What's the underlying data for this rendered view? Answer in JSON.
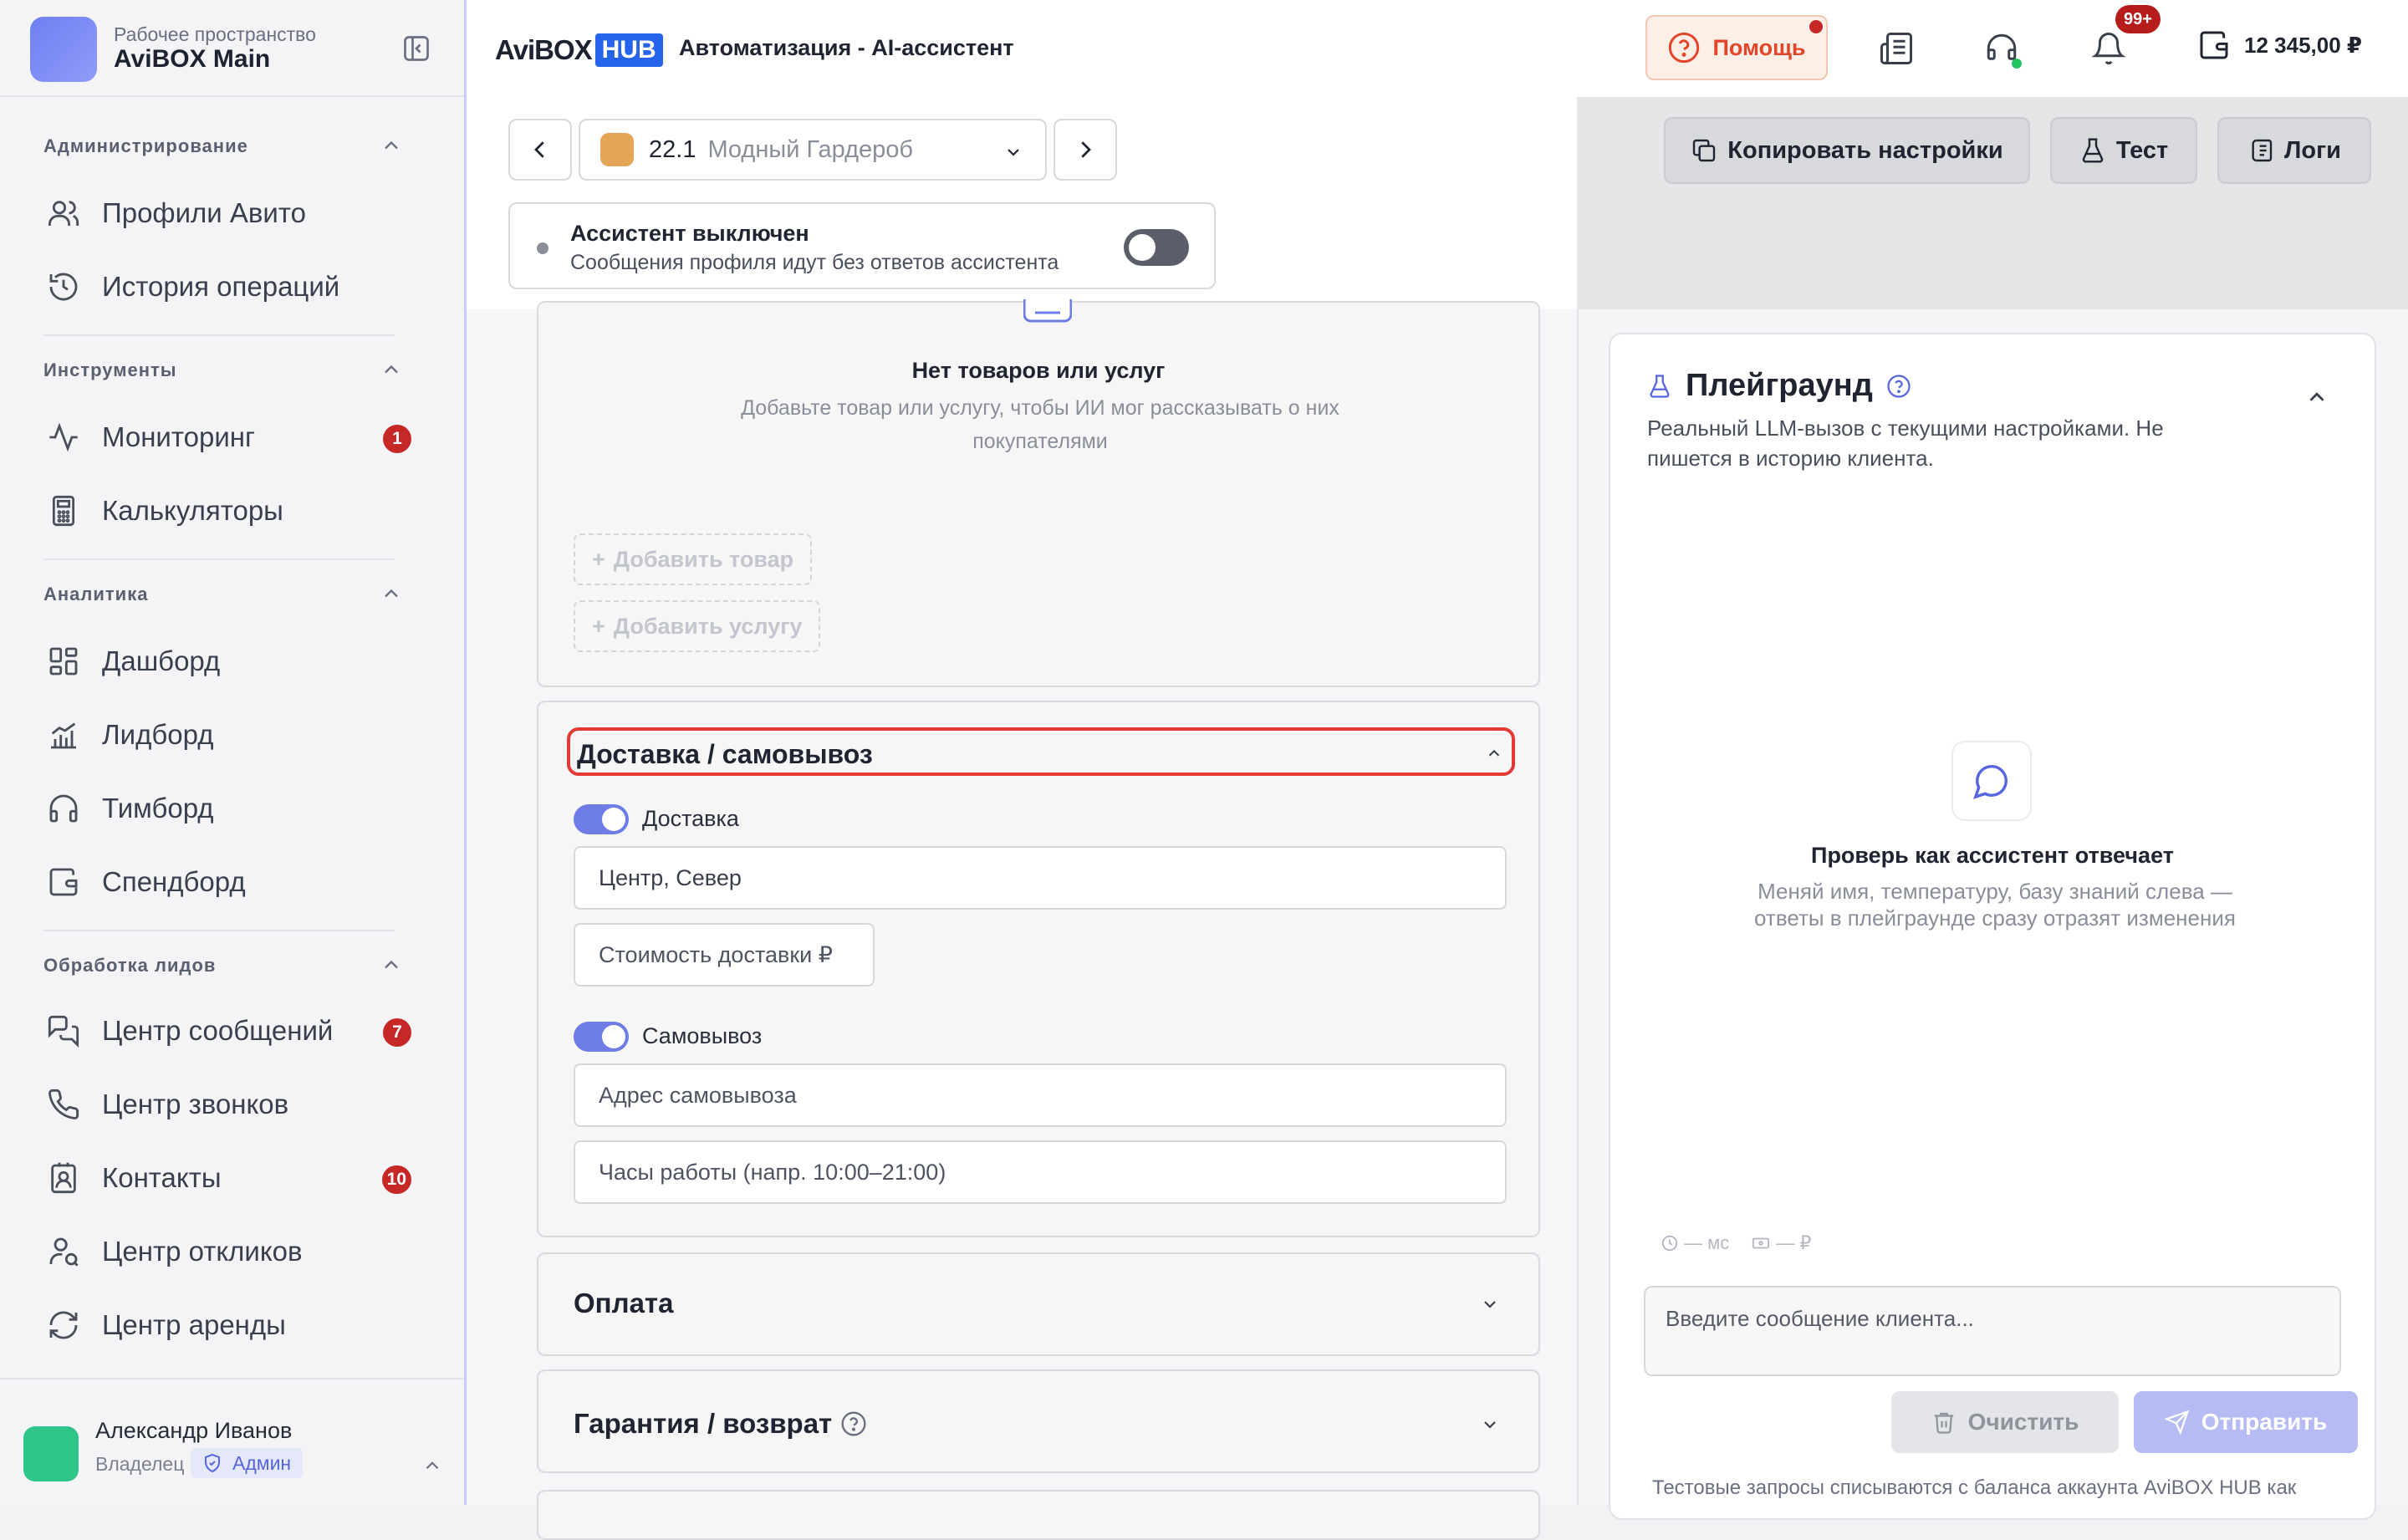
{
  "workspace": {
    "subtitle": "Рабочее пространство",
    "name": "AviBOX Main"
  },
  "sidebar": {
    "sections": [
      {
        "title": "Администрирование",
        "items": [
          {
            "label": "Профили Авито",
            "icon": "users-icon"
          },
          {
            "label": "История операций",
            "icon": "history-icon"
          }
        ]
      },
      {
        "title": "Инструменты",
        "items": [
          {
            "label": "Мониторинг",
            "icon": "activity-icon",
            "badge": "1"
          },
          {
            "label": "Калькуляторы",
            "icon": "calculator-icon"
          }
        ]
      },
      {
        "title": "Аналитика",
        "items": [
          {
            "label": "Дашборд",
            "icon": "dashboard-icon"
          },
          {
            "label": "Лидборд",
            "icon": "bar-chart-icon"
          },
          {
            "label": "Тимборд",
            "icon": "headphones-icon"
          },
          {
            "label": "Спендборд",
            "icon": "wallet-icon"
          }
        ]
      },
      {
        "title": "Обработка лидов",
        "items": [
          {
            "label": "Центр сообщений",
            "icon": "messages-icon",
            "badge": "7"
          },
          {
            "label": "Центр звонков",
            "icon": "phone-icon"
          },
          {
            "label": "Контакты",
            "icon": "contacts-icon",
            "badge": "10"
          },
          {
            "label": "Центр откликов",
            "icon": "user-response-icon"
          },
          {
            "label": "Центр аренды",
            "icon": "refresh-icon"
          }
        ]
      }
    ]
  },
  "user": {
    "name": "Александр Иванов",
    "role": "Владелец",
    "badge": "Админ"
  },
  "topbar": {
    "brand": "AviBOX",
    "brand_hub": "HUB",
    "title": "Автоматизация - AI-ассистент",
    "help": "Помощь",
    "notifications": "99+",
    "balance": "12 345,00 ₽"
  },
  "profile": {
    "number": "22.1",
    "name": "Модный Гардероб"
  },
  "assistant": {
    "title": "Ассистент выключен",
    "subtitle": "Сообщения профиля идут без ответов ассистента",
    "enabled": false
  },
  "actions": {
    "copy": "Копировать настройки",
    "test": "Тест",
    "logs": "Логи"
  },
  "products": {
    "empty_title": "Нет товаров или услуг",
    "empty_sub": "Добавьте товар или услугу, чтобы ИИ мог рассказывать о них покупателями",
    "add_product": "Добавить товар",
    "add_service": "Добавить услугу"
  },
  "delivery": {
    "title": "Доставка / самовывоз",
    "delivery_label": "Доставка",
    "delivery_enabled": true,
    "delivery_area": "Центр, Север",
    "delivery_cost_placeholder": "Стоимость доставки ₽",
    "pickup_label": "Самовывоз",
    "pickup_enabled": true,
    "pickup_address_placeholder": "Адрес самовывоза",
    "pickup_hours_placeholder": "Часы работы (напр. 10:00–21:00)"
  },
  "sections": {
    "payment": "Оплата",
    "warranty": "Гарантия / возврат"
  },
  "playground": {
    "title": "Плейграунд",
    "subtitle": "Реальный LLM-вызов с текущими настройками. Не пишется в историю клиента.",
    "empty_title": "Проверь как ассистент отвечает",
    "empty_sub": "Меняй имя, температуру, базу знаний слева — ответы в плейграунде сразу отразят изменения",
    "latency": "— мс",
    "cost": "— ₽",
    "input_placeholder": "Введите сообщение клиента...",
    "clear": "Очистить",
    "send": "Отправить",
    "note": "Тестовые запросы списываются с баланса аккаунта AviBOX HUB как"
  }
}
